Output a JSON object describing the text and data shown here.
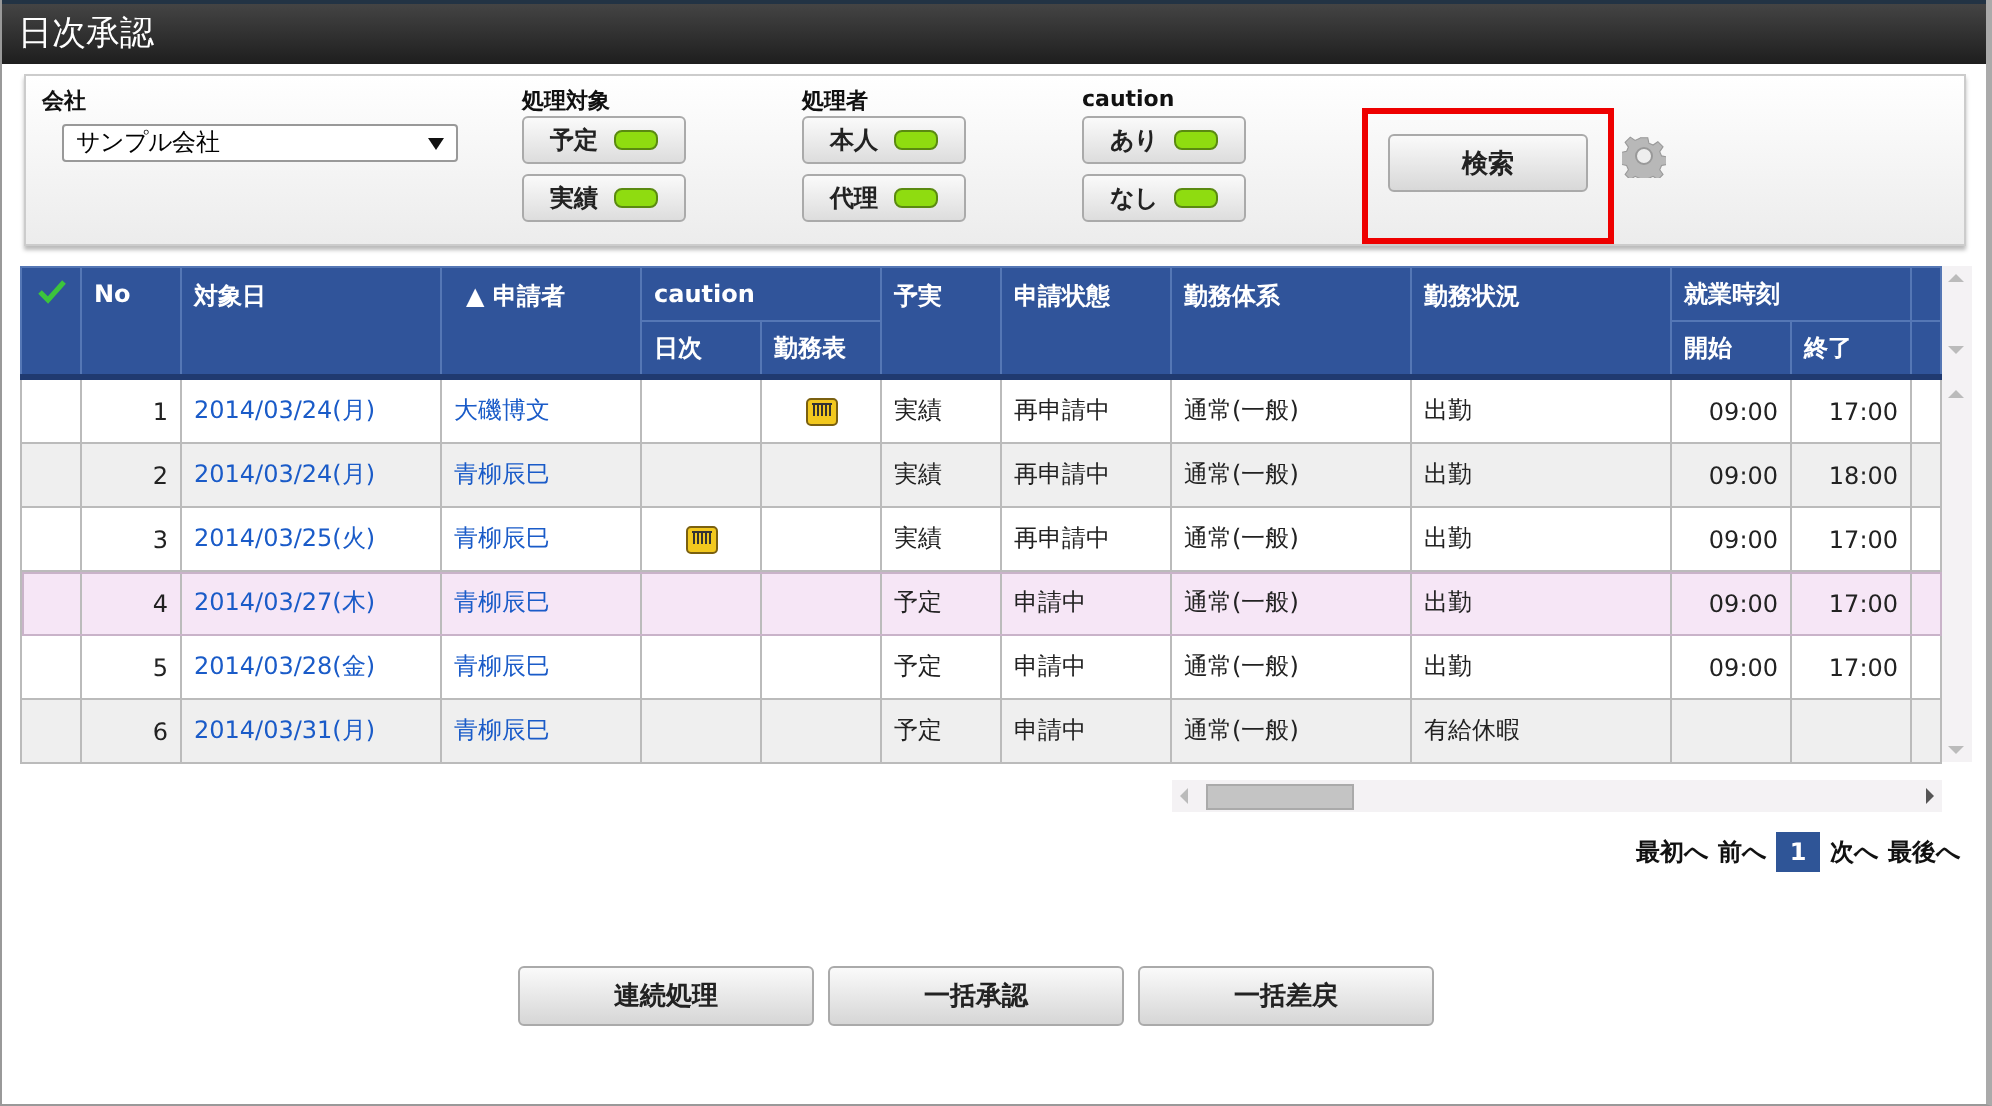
{
  "window": {
    "title": "日次承認"
  },
  "filters": {
    "company": {
      "label": "会社",
      "value": "サンプル会社"
    },
    "groups": [
      {
        "label": "処理対象",
        "toggles": [
          {
            "label": "予定",
            "on": true
          },
          {
            "label": "実績",
            "on": true
          }
        ]
      },
      {
        "label": "処理者",
        "toggles": [
          {
            "label": "本人",
            "on": true
          },
          {
            "label": "代理",
            "on": true
          }
        ]
      },
      {
        "label": "caution",
        "toggles": [
          {
            "label": "あり",
            "on": true
          },
          {
            "label": "なし",
            "on": true
          }
        ]
      }
    ],
    "search_button": {
      "label": "検索",
      "highlighted": true
    }
  },
  "table": {
    "columns": {
      "no": "No",
      "date": "対象日",
      "applicant": "申請者",
      "applicant_sort_mark": "▲",
      "caution": "caution",
      "caution_daily": "日次",
      "caution_sheet": "勤務表",
      "plan_actual": "予実",
      "status": "申請状態",
      "work_system": "勤務体系",
      "work_status": "勤務状況",
      "work_time": "就業時刻",
      "start": "開始",
      "end": "終了"
    },
    "rows": [
      {
        "no": "1",
        "date": "2014/03/24(月)",
        "applicant": "大磯博文",
        "caution_daily": false,
        "caution_sheet": true,
        "plan_actual": "実績",
        "status": "再申請中",
        "work_system": "通常(一般)",
        "work_status": "出勤",
        "start": "09:00",
        "end": "17:00",
        "hovered": false
      },
      {
        "no": "2",
        "date": "2014/03/24(月)",
        "applicant": "青柳辰巳",
        "caution_daily": false,
        "caution_sheet": false,
        "plan_actual": "実績",
        "status": "再申請中",
        "work_system": "通常(一般)",
        "work_status": "出勤",
        "start": "09:00",
        "end": "18:00",
        "hovered": false
      },
      {
        "no": "3",
        "date": "2014/03/25(火)",
        "applicant": "青柳辰巳",
        "caution_daily": true,
        "caution_sheet": false,
        "plan_actual": "実績",
        "status": "再申請中",
        "work_system": "通常(一般)",
        "work_status": "出勤",
        "start": "09:00",
        "end": "17:00",
        "hovered": false
      },
      {
        "no": "4",
        "date": "2014/03/27(木)",
        "applicant": "青柳辰巳",
        "caution_daily": false,
        "caution_sheet": false,
        "plan_actual": "予定",
        "status": "申請中",
        "work_system": "通常(一般)",
        "work_status": "出勤",
        "start": "09:00",
        "end": "17:00",
        "hovered": true
      },
      {
        "no": "5",
        "date": "2014/03/28(金)",
        "applicant": "青柳辰巳",
        "caution_daily": false,
        "caution_sheet": false,
        "plan_actual": "予定",
        "status": "申請中",
        "work_system": "通常(一般)",
        "work_status": "出勤",
        "start": "09:00",
        "end": "17:00",
        "hovered": false
      },
      {
        "no": "6",
        "date": "2014/03/31(月)",
        "applicant": "青柳辰巳",
        "caution_daily": false,
        "caution_sheet": false,
        "plan_actual": "予定",
        "status": "申請中",
        "work_system": "通常(一般)",
        "work_status": "有給休暇",
        "start": "",
        "end": "",
        "hovered": false
      }
    ]
  },
  "pager": {
    "first": "最初へ",
    "prev": "前へ",
    "pages": [
      {
        "label": "1",
        "selected": true
      }
    ],
    "next": "次へ",
    "last": "最後へ"
  },
  "actions": [
    "連続処理",
    "一括承認",
    "一括差戻"
  ]
}
